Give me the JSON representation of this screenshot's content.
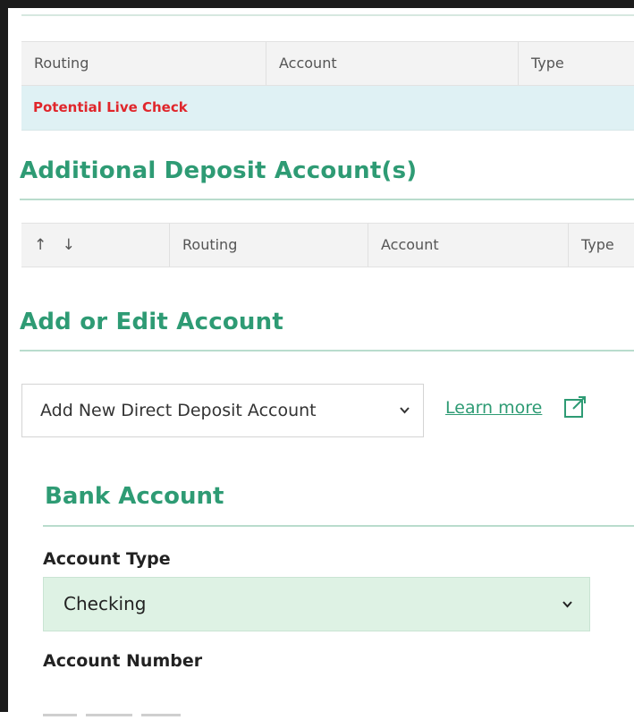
{
  "primary_table": {
    "headers": [
      "Routing",
      "Account",
      "Type"
    ],
    "live_check_label": "Potential Live Check"
  },
  "additional_section": {
    "title": "Additional Deposit Account(s)",
    "sort_arrows": "↑ ↓",
    "headers": [
      "Routing",
      "Account",
      "Type"
    ]
  },
  "add_edit_section": {
    "title": "Add or Edit Account",
    "account_select": {
      "selected": "Add New Direct Deposit Account"
    },
    "learn_more": "Learn more"
  },
  "bank_account": {
    "title": "Bank Account",
    "account_type_label": "Account Type",
    "account_type_value": "Checking",
    "account_number_label": "Account Number"
  },
  "colors": {
    "accent": "#2e9b74",
    "alert": "#e0262b",
    "live_row_bg": "#dff1f4",
    "select_bg": "#def2e4"
  },
  "icons": {
    "external_link": "external-link-icon",
    "chevron": "chevron-down-icon"
  }
}
